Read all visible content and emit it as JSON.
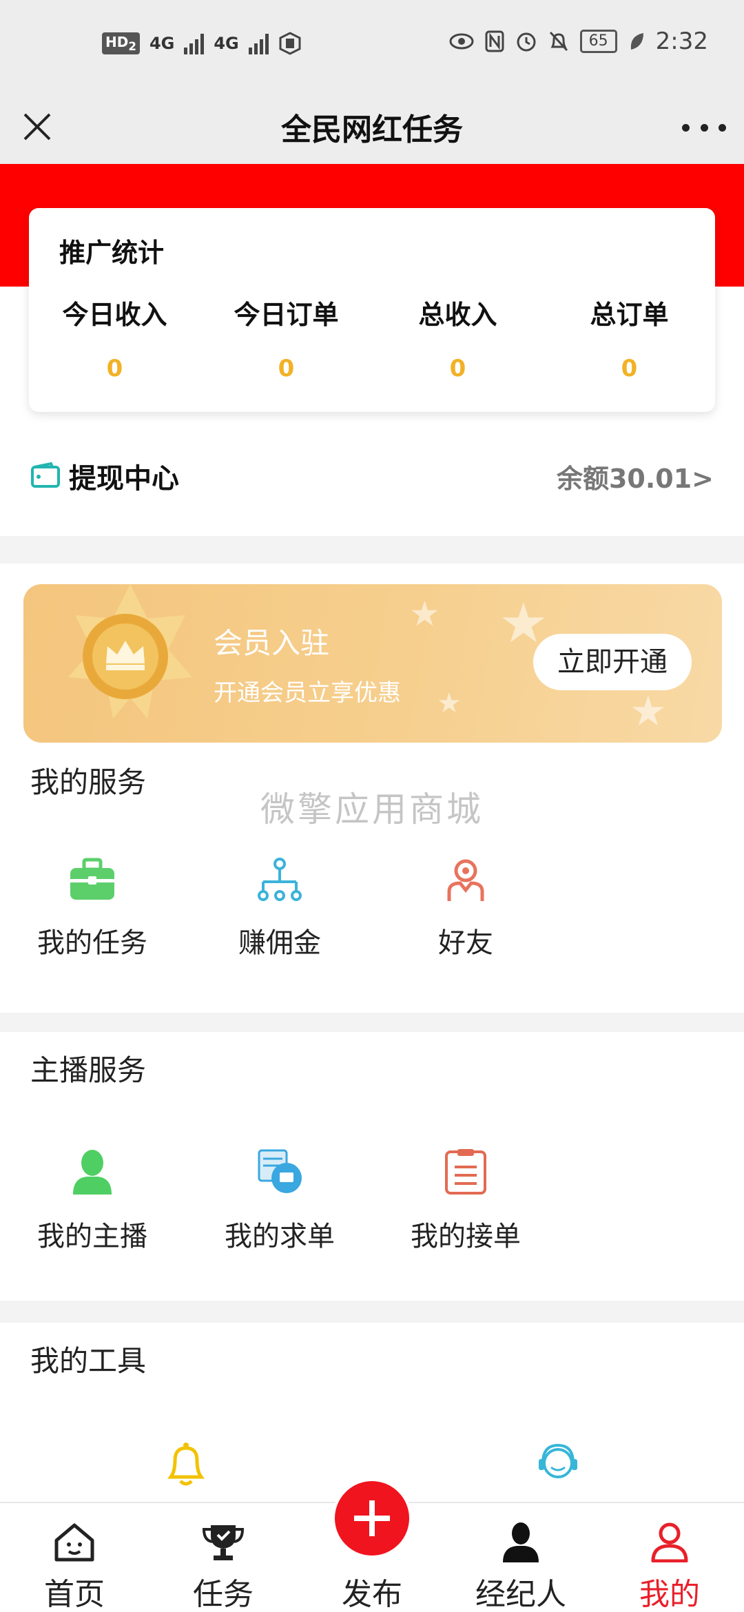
{
  "status_bar": {
    "hd": "HD",
    "hd_sub": "2",
    "net1": "4G",
    "net2": "4G",
    "battery": "65",
    "time": "2:32"
  },
  "header": {
    "title": "全民网红任务"
  },
  "stats": {
    "title": "推广统计",
    "items": [
      {
        "label": "今日收入",
        "value": "0"
      },
      {
        "label": "今日订单",
        "value": "0"
      },
      {
        "label": "总收入",
        "value": "0"
      },
      {
        "label": "总订单",
        "value": "0"
      }
    ]
  },
  "withdraw": {
    "title": "提现中心",
    "balance": "余额30.01>"
  },
  "member": {
    "title": "会员入驻",
    "subtitle": "开通会员立享优惠",
    "button": "立即开通"
  },
  "watermark": "微擎应用商城",
  "my_services": {
    "title": "我的服务",
    "items": [
      {
        "label": "我的任务",
        "icon": "briefcase-icon",
        "color": "#5ccf6b"
      },
      {
        "label": "赚佣金",
        "icon": "network-icon",
        "color": "#3bb3d9"
      },
      {
        "label": "好友",
        "icon": "friend-icon",
        "color": "#e8735d"
      }
    ]
  },
  "anchor_services": {
    "title": "主播服务",
    "items": [
      {
        "label": "我的主播",
        "icon": "person-icon",
        "color": "#4fcf63"
      },
      {
        "label": "我的求单",
        "icon": "request-icon",
        "color": "#3aa7e0"
      },
      {
        "label": "我的接单",
        "icon": "clipboard-icon",
        "color": "#e26a52"
      }
    ]
  },
  "tools": {
    "title": "我的工具",
    "items": [
      {
        "icon": "bell-icon",
        "color": "#f2c200"
      },
      {
        "icon": "customer-service-icon",
        "color": "#37b6d8"
      }
    ]
  },
  "bottom_nav": {
    "items": [
      {
        "label": "首页",
        "icon": "home-icon"
      },
      {
        "label": "任务",
        "icon": "trophy-icon"
      },
      {
        "label": "发布",
        "icon": "plus-icon"
      },
      {
        "label": "经纪人",
        "icon": "agent-icon"
      },
      {
        "label": "我的",
        "icon": "profile-icon",
        "active": true
      }
    ],
    "active_color": "#e8202a"
  }
}
